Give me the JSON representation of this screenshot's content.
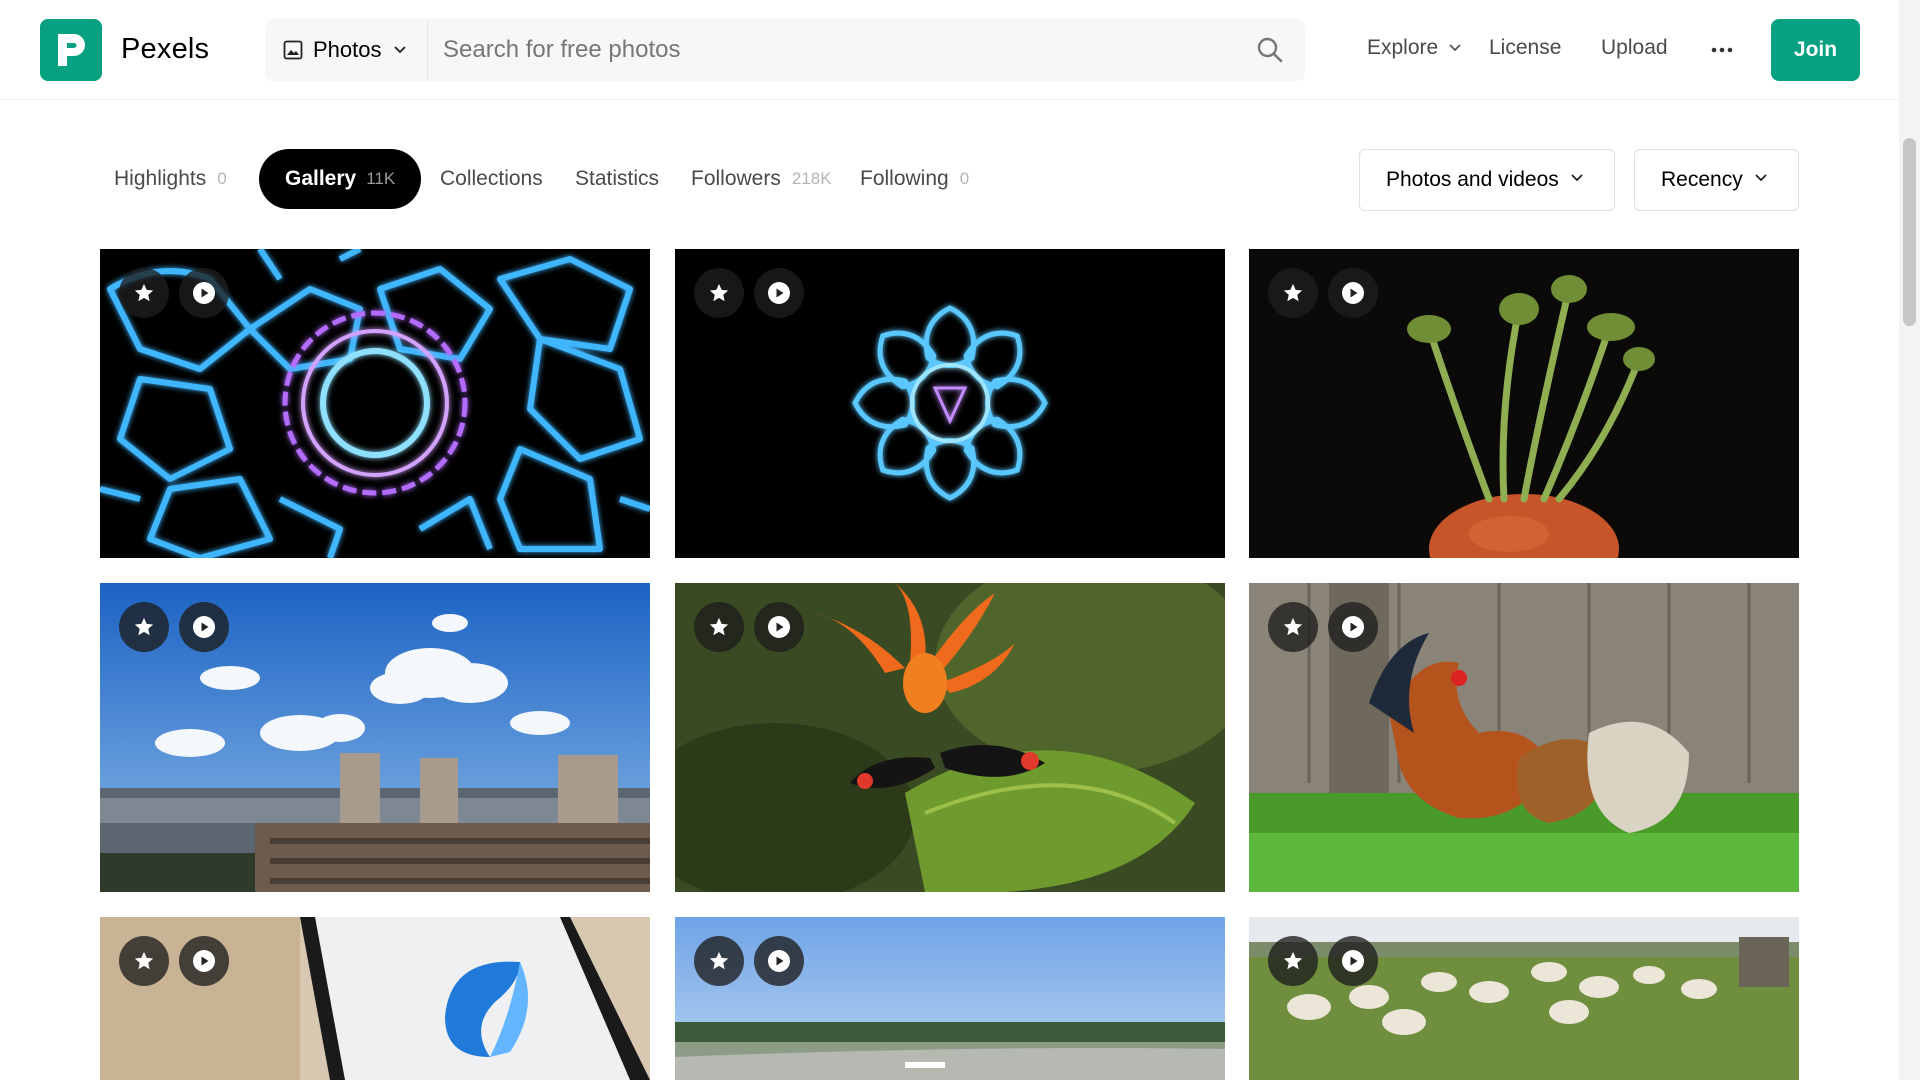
{
  "header": {
    "brand": "Pexels",
    "search": {
      "type_label": "Photos",
      "placeholder": "Search for free photos"
    },
    "nav": {
      "explore": "Explore",
      "license": "License",
      "upload": "Upload",
      "join": "Join"
    }
  },
  "tabs": [
    {
      "label": "Highlights",
      "count": "0",
      "active": false
    },
    {
      "label": "Gallery",
      "count": "11K",
      "active": true
    },
    {
      "label": "Collections",
      "count": "",
      "active": false
    },
    {
      "label": "Statistics",
      "count": "",
      "active": false
    },
    {
      "label": "Followers",
      "count": "218K",
      "active": false
    },
    {
      "label": "Following",
      "count": "0",
      "active": false
    }
  ],
  "filters": {
    "media": "Photos and videos",
    "sort": "Recency"
  },
  "gallery": [
    {
      "subject": "neon-blue-voronoi-kaleidoscope",
      "type": "video"
    },
    {
      "subject": "neon-blue-mandala-on-black",
      "type": "video"
    },
    {
      "subject": "carrot-sprouting-greens",
      "type": "video"
    },
    {
      "subject": "city-skyline-blue-sky-clouds",
      "type": "video"
    },
    {
      "subject": "butterfly-on-orange-flower",
      "type": "video"
    },
    {
      "subject": "rooster-and-hens-on-grass",
      "type": "video"
    },
    {
      "subject": "monitor-with-blue-logo",
      "type": "video"
    },
    {
      "subject": "airport-runway-airplane",
      "type": "video"
    },
    {
      "subject": "sheep-grazing-field",
      "type": "video"
    }
  ],
  "colors": {
    "brand": "#07a081",
    "active_tab": "#000000",
    "text": "#4a4a4a",
    "muted_count": "#b4b4b4"
  },
  "icons": {
    "logo": "pexels-logo-icon",
    "image": "image-icon",
    "search": "search-icon",
    "chevron": "chevron-down-icon",
    "more": "more-dots-icon",
    "star": "star-icon",
    "play": "play-icon"
  }
}
